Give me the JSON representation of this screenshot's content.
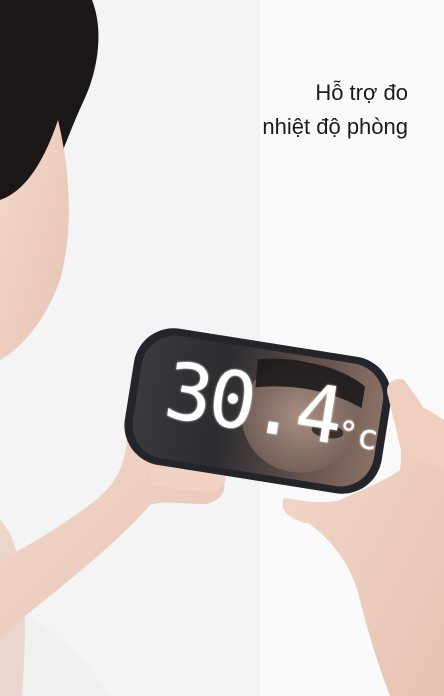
{
  "caption": {
    "line1": "Hỗ trợ đo",
    "line2": "nhiệt độ phòng"
  },
  "clock_display": {
    "temperature": "30.4",
    "unit": "°c"
  }
}
